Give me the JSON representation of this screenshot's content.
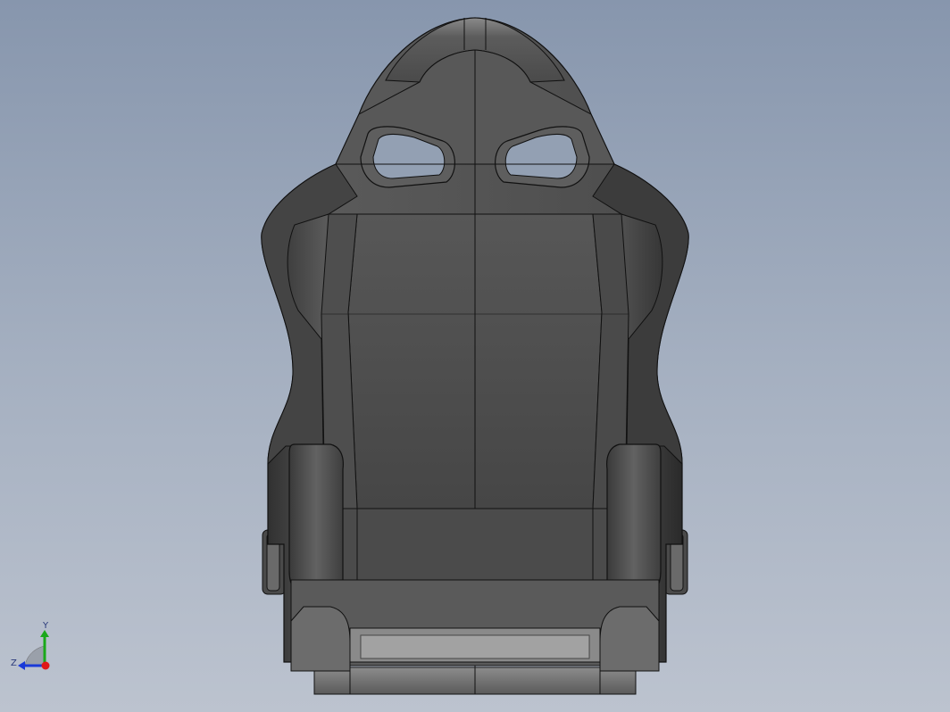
{
  "view": {
    "background_top": "#8796ad",
    "background_bottom": "#bcc3cf",
    "model": "racing-seat",
    "display_style": "shaded-with-edges"
  },
  "triad": {
    "y_label": "Y",
    "z_label": "Z",
    "x_color": "#e01818",
    "y_color": "#1aa81a",
    "z_color": "#1a3ad8"
  }
}
